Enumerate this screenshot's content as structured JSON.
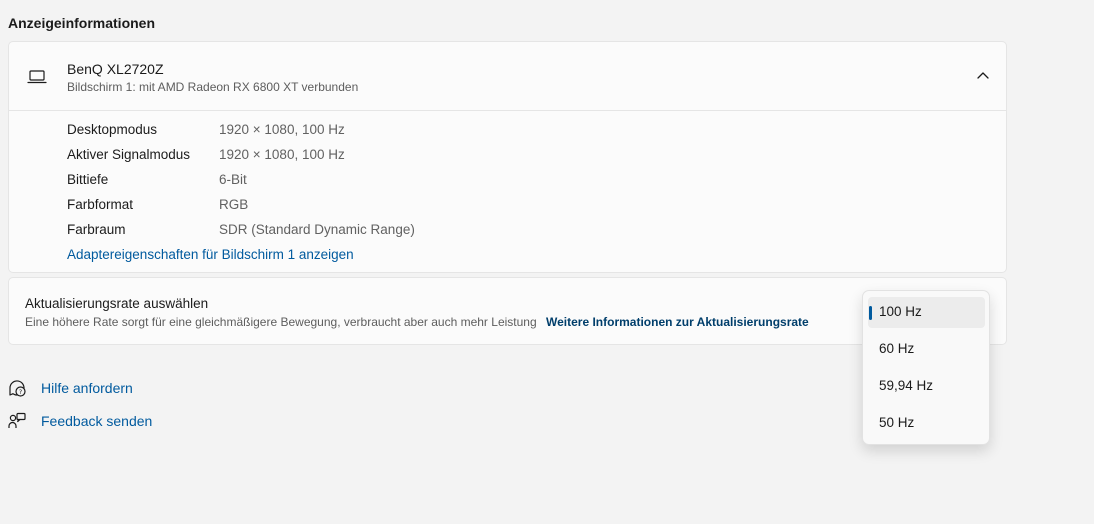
{
  "section_title": "Anzeigeinformationen",
  "monitor": {
    "name": "BenQ XL2720Z",
    "subtitle": "Bildschirm 1: mit AMD Radeon RX 6800 XT verbunden",
    "icon": "laptop-icon",
    "expand_icon": "chevron-up-icon"
  },
  "properties": [
    {
      "label": "Desktopmodus",
      "value": "1920 × 1080, 100 Hz"
    },
    {
      "label": "Aktiver Signalmodus",
      "value": "1920 × 1080, 100 Hz"
    },
    {
      "label": "Bittiefe",
      "value": "6-Bit"
    },
    {
      "label": "Farbformat",
      "value": "RGB"
    },
    {
      "label": "Farbraum",
      "value": "SDR (Standard Dynamic Range)"
    }
  ],
  "adapter_link": "Adaptereigenschaften für Bildschirm 1 anzeigen",
  "refresh_rate": {
    "title": "Aktualisierungsrate auswählen",
    "description": "Eine höhere Rate sorgt für eine gleichmäßigere Bewegung, verbraucht aber auch mehr Leistung",
    "more_info_link": "Weitere Informationen zur Aktualisierungsrate",
    "options": [
      "100 Hz",
      "60 Hz",
      "59,94 Hz",
      "50 Hz"
    ],
    "selected": "100 Hz"
  },
  "help_links": {
    "help": "Hilfe anfordern",
    "help_icon": "help-chat-icon",
    "feedback": "Feedback senden",
    "feedback_icon": "feedback-icon"
  },
  "colors": {
    "accent": "#005a9e",
    "background": "#f3f3f3",
    "card": "#fbfbfb"
  }
}
